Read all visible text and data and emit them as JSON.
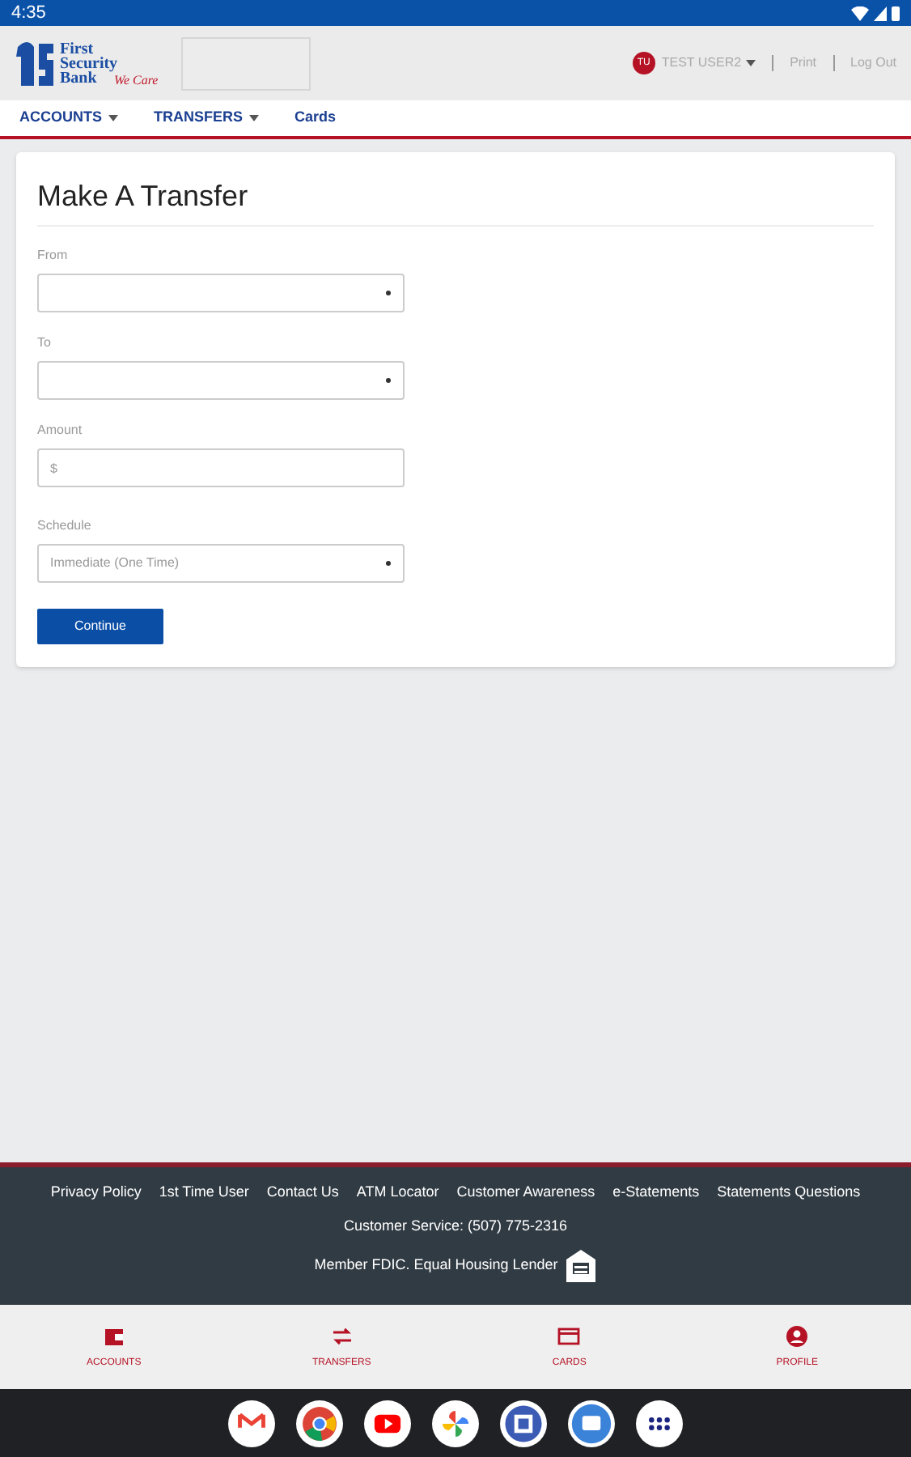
{
  "status_bar": {
    "time": "4:35"
  },
  "header": {
    "logo_lines": [
      "First",
      "Security",
      "Bank"
    ],
    "logo_tagline": "We Care",
    "avatar": "TU",
    "user": "TEST USER2",
    "links": [
      "Print",
      "Log Out"
    ]
  },
  "nav": [
    {
      "label": "ACCOUNTS",
      "dropdown": true
    },
    {
      "label": "TRANSFERS",
      "dropdown": true
    },
    {
      "label": "Cards",
      "dropdown": false
    }
  ],
  "form": {
    "title": "Make A Transfer",
    "fields": [
      {
        "label": "From",
        "kind": "select"
      },
      {
        "label": "To",
        "kind": "select"
      },
      {
        "label": "Amount",
        "kind": "input",
        "placeholder": "$"
      },
      {
        "label": "Schedule",
        "kind": "select",
        "value": "Immediate (One Time)"
      }
    ],
    "button": "Continue"
  },
  "footer": {
    "links": [
      "Privacy Policy",
      "1st Time User",
      "Contact Us",
      "ATM Locator",
      "Customer Awareness",
      "e-Statements",
      "Statements Questions"
    ],
    "service": "Customer Service: (507) 775-2316",
    "member": "Member FDIC. Equal Housing Lender"
  },
  "bottom_nav": [
    {
      "label": "ACCOUNTS"
    },
    {
      "label": "TRANSFERS"
    },
    {
      "label": "CARDS"
    },
    {
      "label": "PROFILE"
    }
  ]
}
